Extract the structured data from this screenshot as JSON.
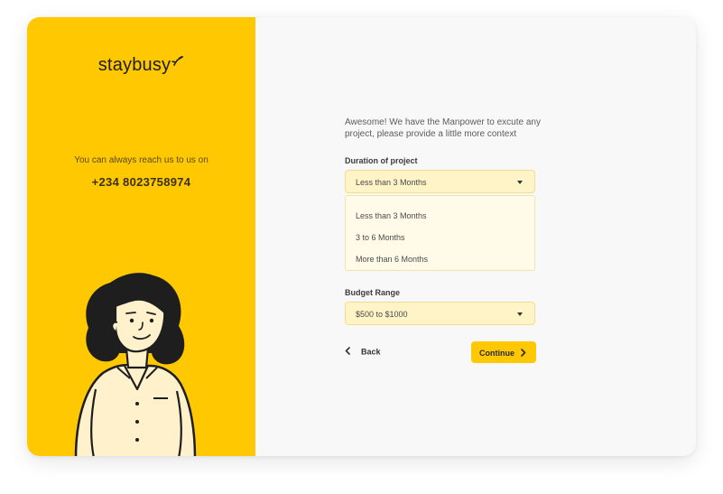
{
  "brand": {
    "name": "staybusy"
  },
  "contact": {
    "prompt": "You can always reach us to us on",
    "phone": "+234 8023758974"
  },
  "form": {
    "intro": "Awesome! We have the Manpower to excute any project, please provide a little more context",
    "duration": {
      "label": "Duration of project",
      "selected": "Less than 3 Months",
      "options": [
        "Less than 3 Months",
        "3 to 6 Months",
        "More than 6 Months"
      ]
    },
    "budget": {
      "label": "Budget Range",
      "selected": "$500 to $1000"
    },
    "back_label": "Back",
    "continue_label": "Continue"
  },
  "colors": {
    "accent": "#ffc800",
    "select_bg": "#fff4c7",
    "panel_bg": "#f8f8f8"
  },
  "icons": [
    "leaf-sprout-icon",
    "chevron-down-icon",
    "chevron-left-icon",
    "chevron-right-icon"
  ]
}
